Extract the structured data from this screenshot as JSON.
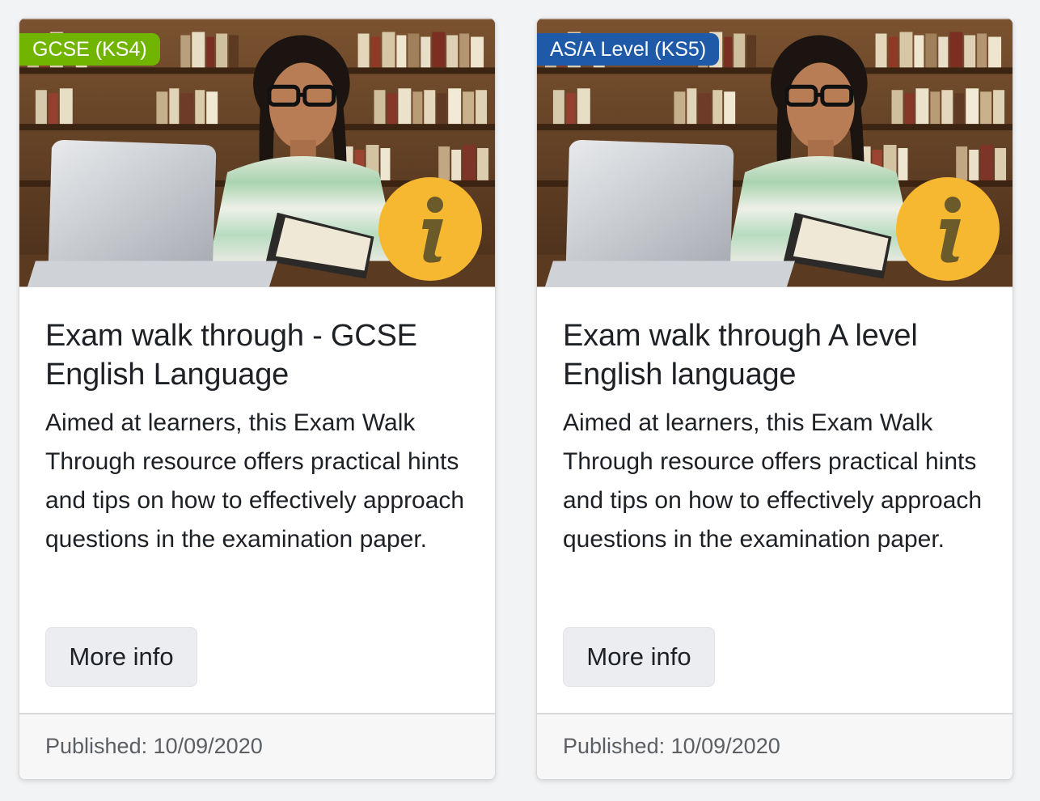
{
  "cards": [
    {
      "badge": "GCSE (KS4)",
      "badge_color": "#72b500",
      "title": "Exam walk through - GCSE English Language",
      "description": "Aimed at learners, this Exam Walk Through resource offers practical hints and tips on how to effectively approach questions in the examination paper.",
      "button_label": "More info",
      "published": "Published: 10/09/2020",
      "image": "student-laptop-library-photo",
      "info_icon": "info-icon"
    },
    {
      "badge": "AS/A Level (KS5)",
      "badge_color": "#1f5aa8",
      "title": "Exam walk through A level English language",
      "description": "Aimed at learners, this Exam Walk Through resource offers practical hints and tips on how to effectively approach questions in the examination paper.",
      "button_label": "More info",
      "published": "Published: 10/09/2020",
      "image": "student-laptop-library-photo",
      "info_icon": "info-icon"
    }
  ],
  "colors": {
    "info_badge": "#f6b830",
    "info_glyph": "#6b5a2a"
  }
}
